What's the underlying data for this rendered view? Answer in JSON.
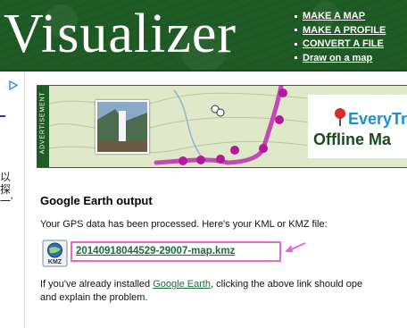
{
  "header": {
    "logo_text": "Visualizer",
    "nav": [
      {
        "label": "MAKE A MAP"
      },
      {
        "label": "MAKE A PROFILE"
      },
      {
        "label": "CONVERT A FILE"
      },
      {
        "label": "Draw on a map"
      }
    ]
  },
  "left_rail": {
    "cjk_chars": [
      "以",
      "探",
      "一'"
    ]
  },
  "ad": {
    "side_label": "ADVERTISEMENT",
    "brand_name": "EveryTr",
    "tagline": "Offline Ma"
  },
  "main": {
    "title": "Google Earth output",
    "message": "Your GPS data has been processed. Here's your KML or KMZ file:",
    "file_icon_label": "KMZ",
    "file_link": "20140918044529-29007-map.kmz",
    "note_prefix": "If you've already installed ",
    "note_link": "Google Earth",
    "note_suffix": ", clicking the above link should ope",
    "note_line2": "and explain the problem."
  },
  "colors": {
    "header_green": "#1f5b24",
    "link_green": "#1e6b3a",
    "highlight_pink": "#e06bd6",
    "brand_blue": "#1b8fd6"
  }
}
